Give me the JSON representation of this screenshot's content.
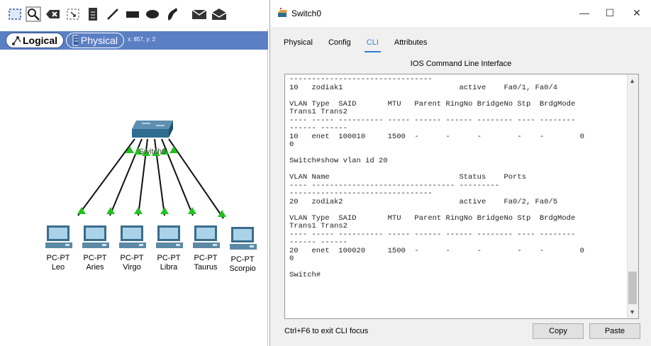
{
  "toolbar": {
    "icons": [
      "select-icon",
      "inspect-icon",
      "delete-icon",
      "resize-icon",
      "note-icon",
      "line-icon",
      "rectangle-icon",
      "ellipse-icon",
      "freeform-icon",
      "simple-pdu-icon",
      "complex-pdu-icon"
    ]
  },
  "workspace": {
    "logical_label": "Logical",
    "physical_label": "Physical",
    "coords": "x: 857, y: 2",
    "switch_label": "Switch0",
    "pcs": [
      {
        "type": "PC-PT",
        "name": "Leo"
      },
      {
        "type": "PC-PT",
        "name": "Aries"
      },
      {
        "type": "PC-PT",
        "name": "Virgo"
      },
      {
        "type": "PC-PT",
        "name": "Libra"
      },
      {
        "type": "PC-PT",
        "name": "Taurus"
      },
      {
        "type": "PC-PT",
        "name": "Scorpio"
      }
    ],
    "link_color": "#22c022"
  },
  "window": {
    "title": "Switch0",
    "minimize": "—",
    "maximize": "☐",
    "close": "✕",
    "tabs": [
      "Physical",
      "Config",
      "CLI",
      "Attributes"
    ],
    "active_tab": "CLI",
    "accent": "#2f80d8",
    "cli_title": "IOS Command Line Interface",
    "terminal_text": "--------------------------------\n10   zodiak1                          active    Fa0/1, Fa0/4\n\nVLAN Type  SAID       MTU   Parent RingNo BridgeNo Stp  BrdgMode\nTrans1 Trans2\n---- ----- ---------- ----- ------ ------ -------- ---- --------\n------ ------\n10   enet  100010     1500  -      -      -        -    -        0\n0\n\nSwitch#show vlan id 20\n\nVLAN Name                             Status    Ports\n---- -------------------------------- --------- \n--------------------------------\n20   zodiak2                          active    Fa0/2, Fa0/5\n\nVLAN Type  SAID       MTU   Parent RingNo BridgeNo Stp  BrdgMode\nTrans1 Trans2\n---- ----- ---------- ----- ------ ------ -------- ---- --------\n------ ------\n20   enet  100020     1500  -      -      -        -    -        0\n0\n\nSwitch#",
    "hint": "Ctrl+F6 to exit CLI focus",
    "copy_label": "Copy",
    "paste_label": "Paste"
  }
}
